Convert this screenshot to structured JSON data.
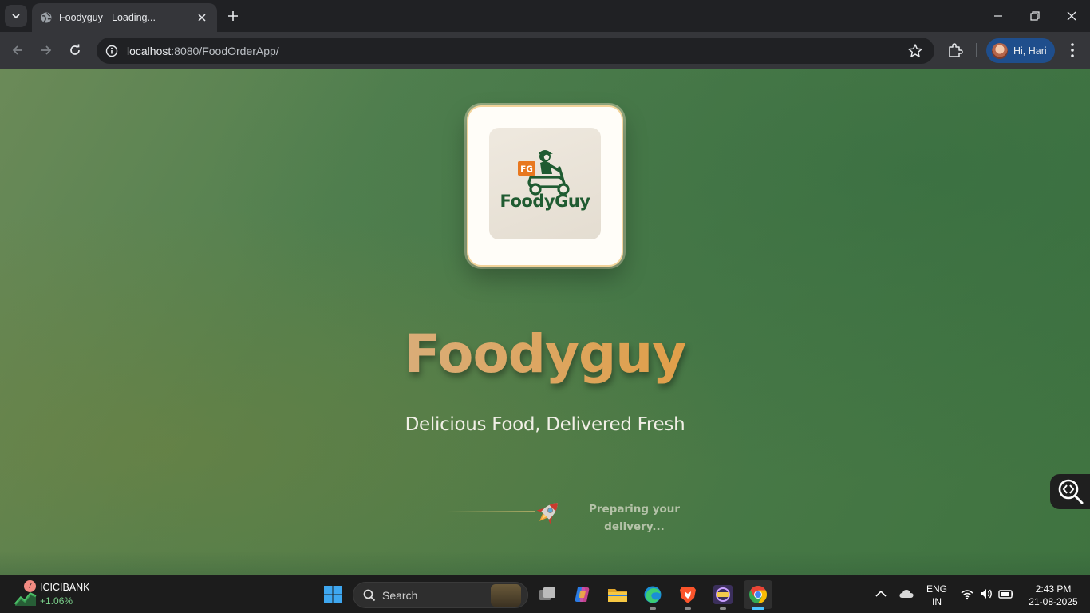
{
  "browser": {
    "tab": {
      "title": "Foodyguy - Loading..."
    },
    "address": {
      "host": "localhost",
      "path": ":8080/FoodOrderApp/"
    },
    "profile": {
      "label": "Hi, Hari"
    }
  },
  "page": {
    "logo": {
      "badge": "FG",
      "wordmark": "FoodyGuy"
    },
    "title": "Foodyguy",
    "tagline": "Delicious Food, Delivered Fresh",
    "loading_text": "Preparing your delivery...",
    "colors": {
      "brand_green": "#1f5b31",
      "accent_orange": "#e8781f",
      "background_green": "#4a7a48"
    }
  },
  "taskbar": {
    "stock": {
      "name": "ICICIBANK",
      "change": "+1.06%",
      "badge_count": "7"
    },
    "search": {
      "label": "Search"
    },
    "language": {
      "line1": "ENG",
      "line2": "IN"
    },
    "clock": {
      "time": "2:43 PM",
      "date": "21-08-2025"
    },
    "apps": [
      "task-view",
      "copilot",
      "file-explorer",
      "edge",
      "brave",
      "game-app",
      "chrome"
    ]
  }
}
